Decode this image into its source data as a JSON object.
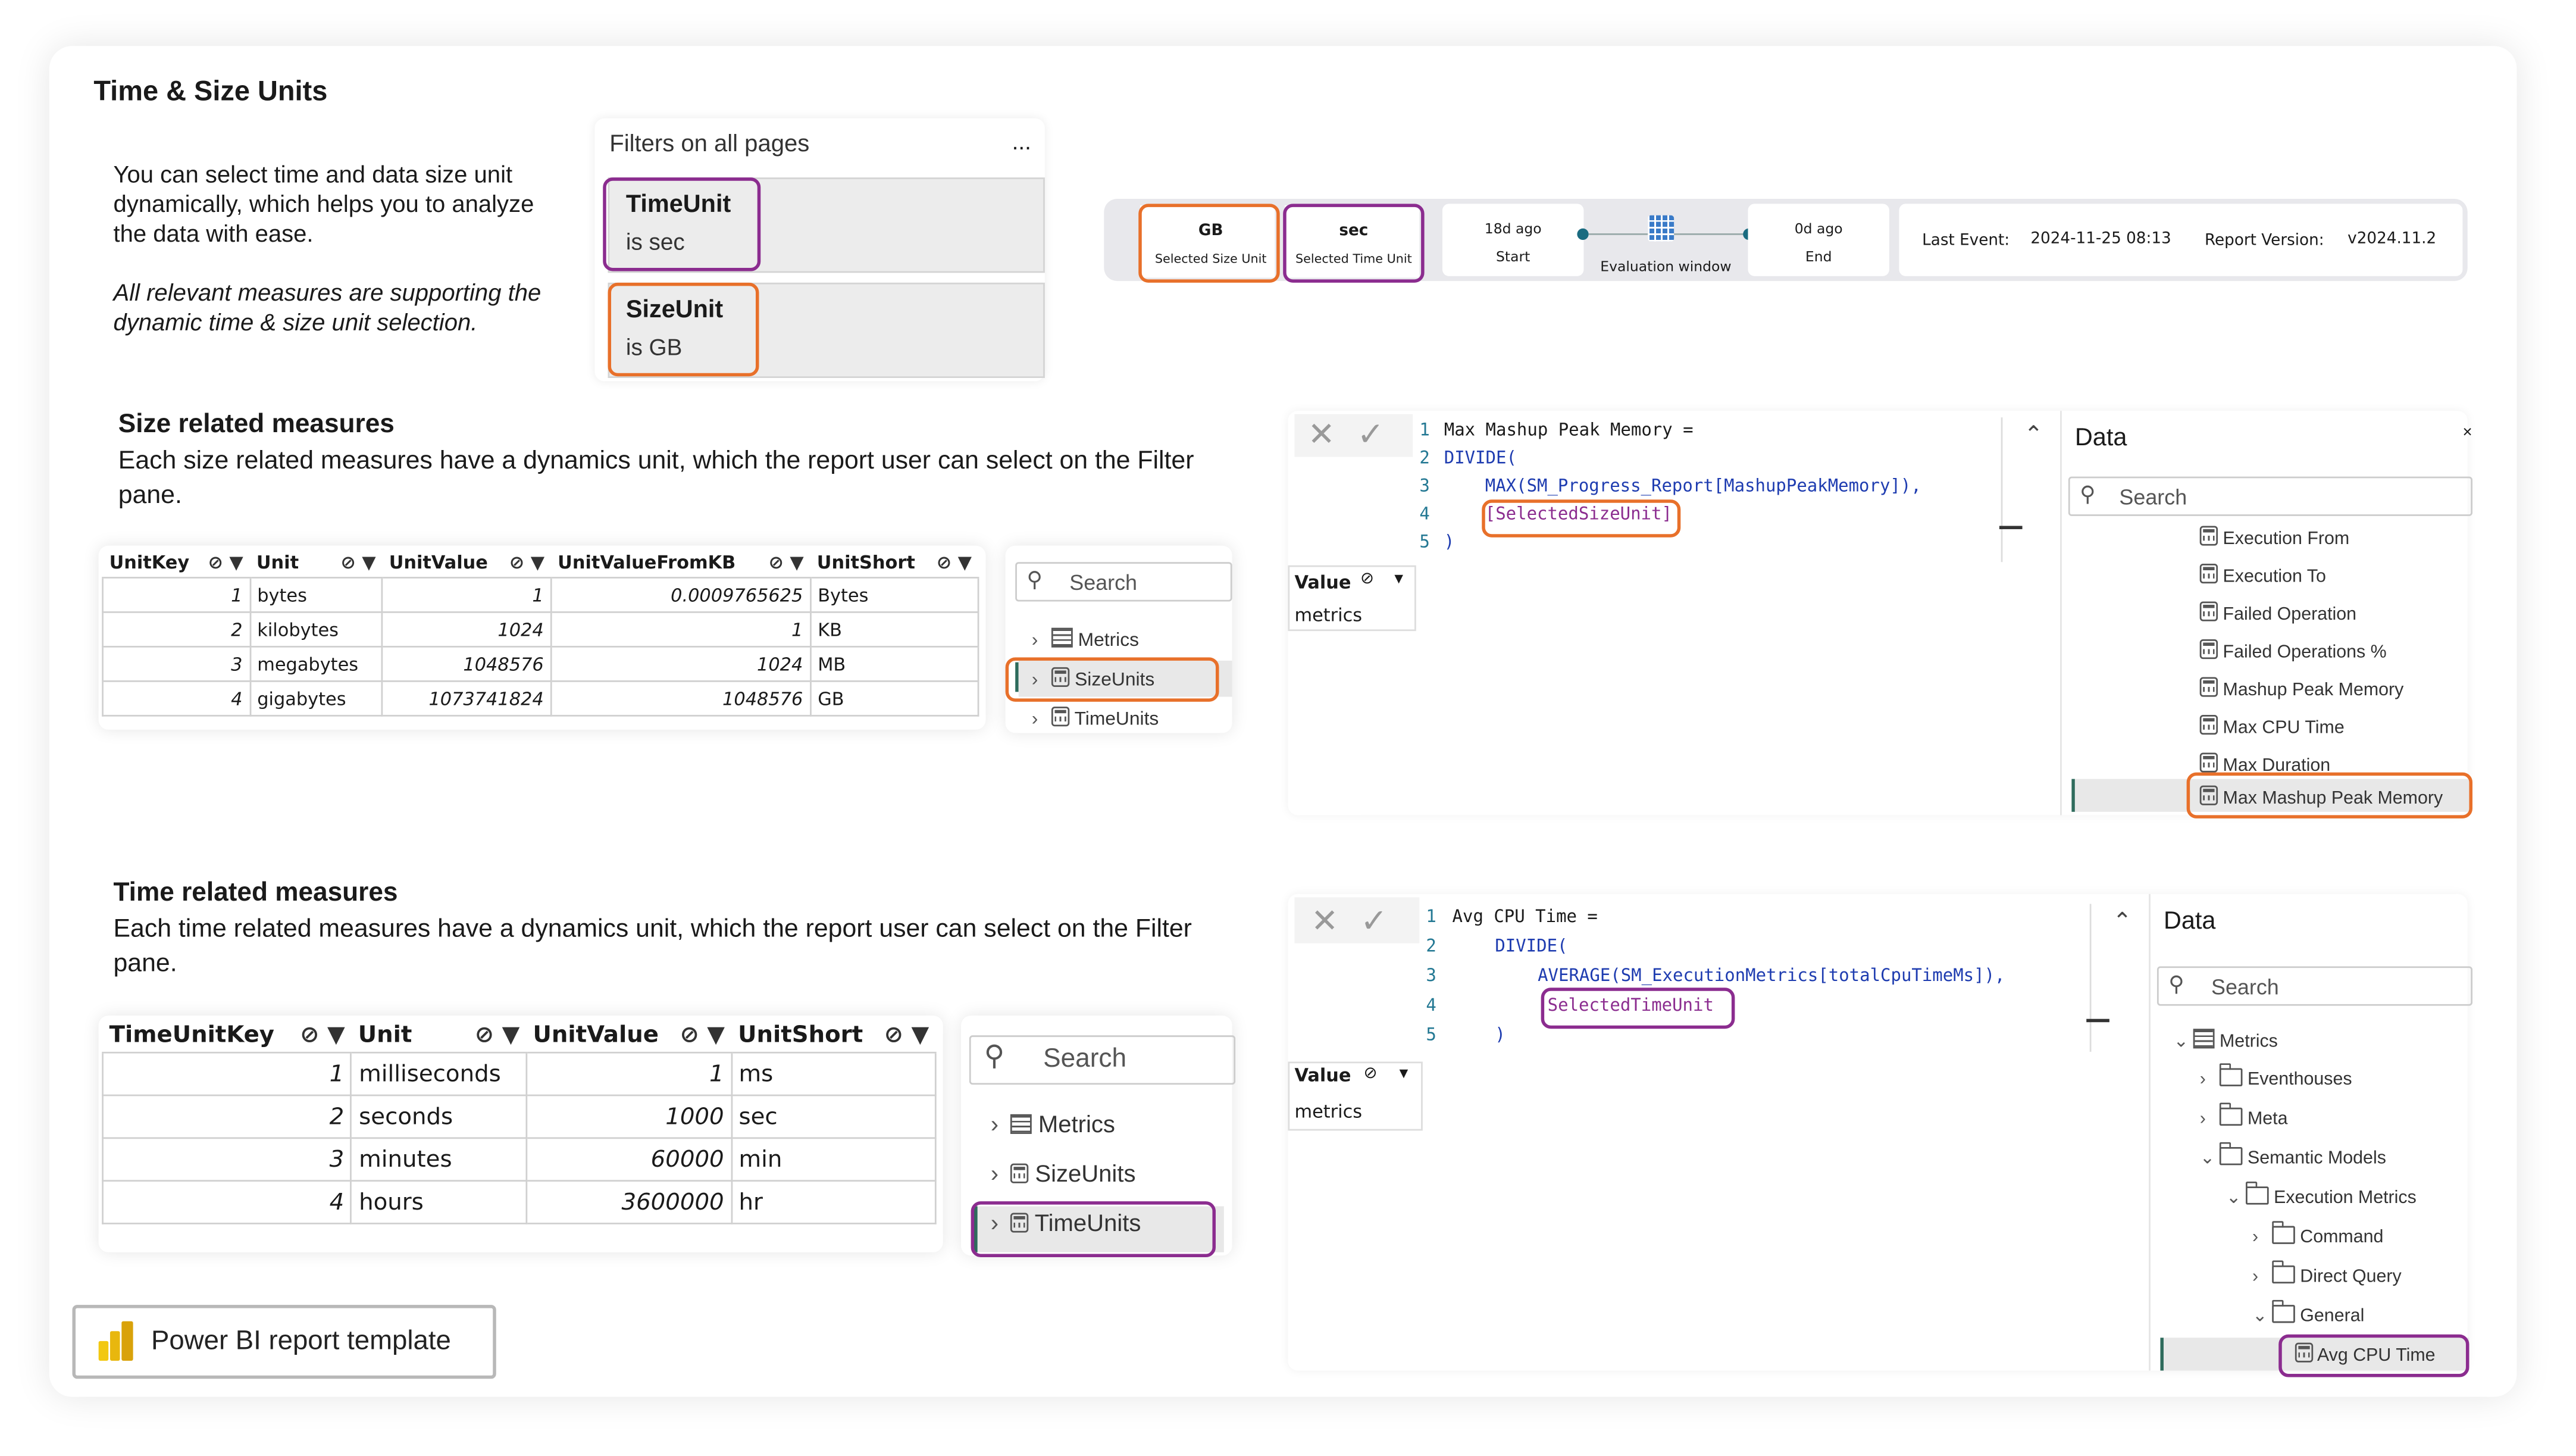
{
  "title": "Time & Size Units",
  "intro": {
    "paragraph": "You can select time and data size unit dynamically, which helps you to analyze the data with ease.",
    "note": "All relevant measures are supporting the dynamic time & size unit selection."
  },
  "filters": {
    "header": "Filters on all pages",
    "more": "...",
    "cards": [
      {
        "name": "TimeUnit",
        "value": "is sec"
      },
      {
        "name": "SizeUnit",
        "value": "is GB"
      }
    ]
  },
  "slicer_bar": {
    "size_value": "GB",
    "size_label": "Selected Size Unit",
    "time_value": "sec",
    "time_label": "Selected Time Unit",
    "start_value": "18d ago",
    "start_label": "Start",
    "window_label": "Evaluation window",
    "end_value": "0d ago",
    "end_label": "End",
    "last_event_label": "Last Event:",
    "last_event_value": "2024-11-25 08:13",
    "version_label": "Report Version:",
    "version_value": "v2024.11.2"
  },
  "size_section": {
    "heading": "Size related measures",
    "text": "Each size related measures have a dynamics unit, which the report user can select on the Filter pane.",
    "columns": [
      "UnitKey",
      "Unit",
      "UnitValue",
      "UnitValueFromKB",
      "UnitShort"
    ],
    "rows": [
      [
        "1",
        "bytes",
        "1",
        "0.0009765625",
        "Bytes"
      ],
      [
        "2",
        "kilobytes",
        "1024",
        "1",
        "KB"
      ],
      [
        "3",
        "megabytes",
        "1048576",
        "1024",
        "MB"
      ],
      [
        "4",
        "gigabytes",
        "1073741824",
        "1048576",
        "GB"
      ]
    ],
    "search": "Search",
    "tree": [
      "Metrics",
      "SizeUnits",
      "TimeUnits"
    ]
  },
  "time_section": {
    "heading": "Time related measures",
    "text": "Each time related measures have a dynamics unit, which the report user can select on the Filter pane.",
    "columns": [
      "TimeUnitKey",
      "Unit",
      "UnitValue",
      "UnitShort"
    ],
    "rows": [
      [
        "1",
        "milliseconds",
        "1",
        "ms"
      ],
      [
        "2",
        "seconds",
        "1000",
        "sec"
      ],
      [
        "3",
        "minutes",
        "60000",
        "min"
      ],
      [
        "4",
        "hours",
        "3600000",
        "hr"
      ]
    ],
    "search": "Search",
    "tree": [
      "Metrics",
      "SizeUnits",
      "TimeUnits"
    ]
  },
  "size_editor": {
    "lines": [
      "Max Mashup Peak Memory =",
      "DIVIDE(",
      "MAX(SM_Progress_Report[MashupPeakMemory]),",
      "[SelectedSizeUnit]",
      ")"
    ],
    "value_header": "Value",
    "value_cell": "metrics",
    "data_title": "Data",
    "search": "Search",
    "items": [
      "Execution From",
      "Execution To",
      "Failed Operation",
      "Failed Operations %",
      "Mashup Peak Memory",
      "Max CPU Time",
      "Max Duration",
      "Max Mashup Peak Memory"
    ]
  },
  "time_editor": {
    "lines": [
      "Avg CPU Time =",
      "DIVIDE(",
      "AVERAGE(SM_ExecutionMetrics[totalCpuTimeMs]),",
      "SelectedTimeUnit",
      ")"
    ],
    "value_header": "Value",
    "value_cell": "metrics",
    "data_title": "Data",
    "search": "Search",
    "tree": [
      "Metrics",
      "Eventhouses",
      "Meta",
      "Semantic Models",
      "Execution Metrics",
      "Command",
      "Direct Query",
      "General",
      "Avg CPU Time"
    ]
  },
  "button_label": "Power BI report template",
  "colors": {
    "orange": "#e8702a",
    "purple": "#8b2c8f",
    "powerbi_yellow": "#f2c811",
    "selected_bar": "#2e6b5c"
  }
}
